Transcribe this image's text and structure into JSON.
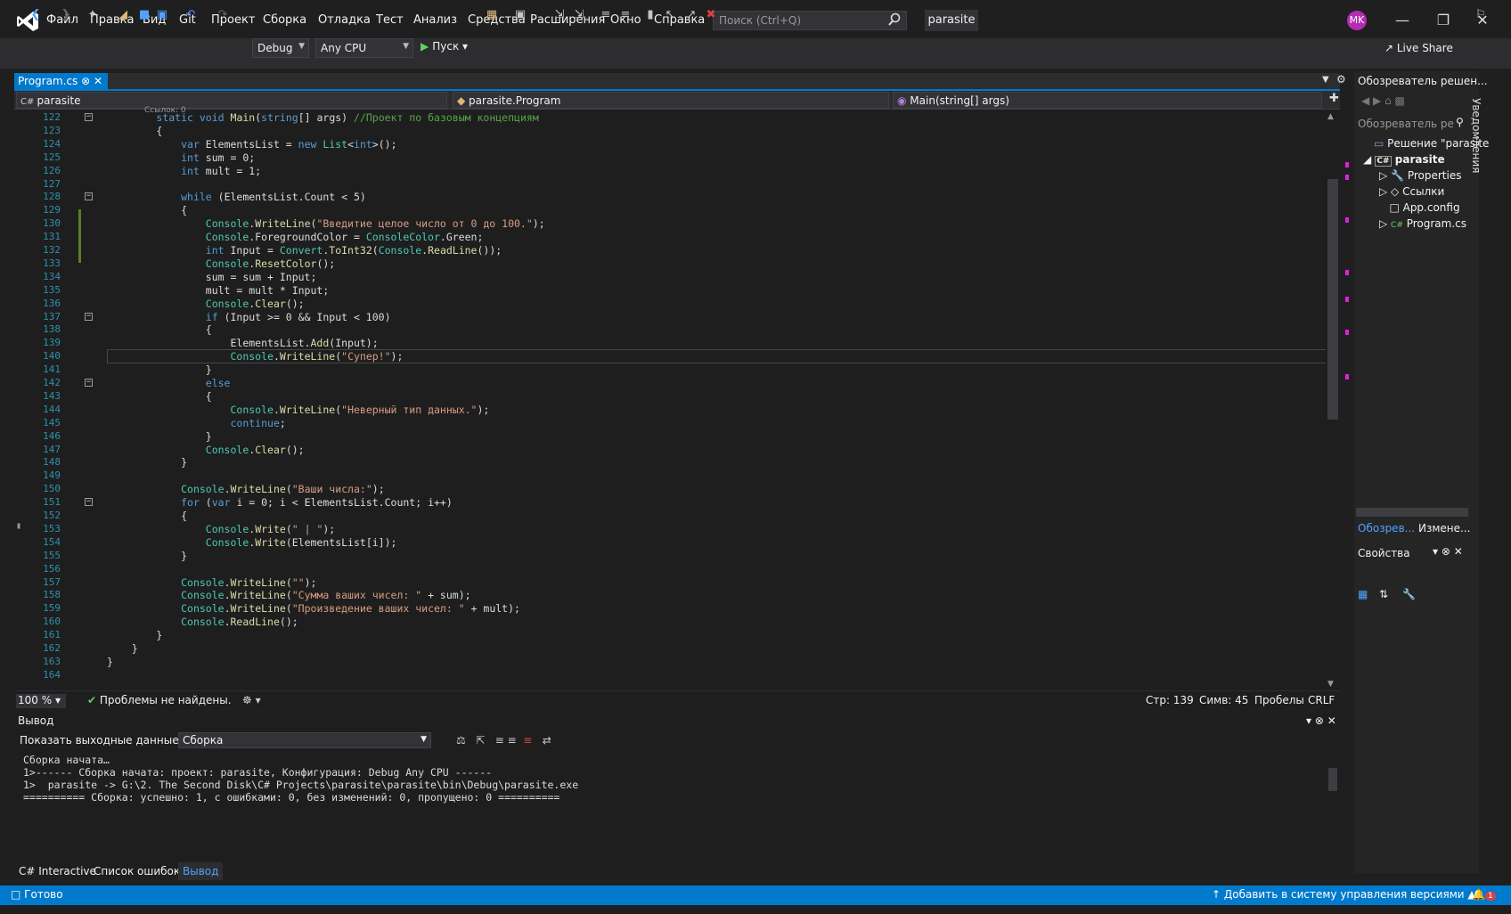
{
  "menu": {
    "items": [
      "Файл",
      "Правка",
      "Вид",
      "Git",
      "Проект",
      "Сборка",
      "Отладка",
      "Тест",
      "Анализ",
      "Средства",
      "Расширения",
      "Окно",
      "Справка"
    ],
    "search_placeholder": "Поиск (Ctrl+Q)",
    "project_name": "parasite",
    "avatar_initials": "MK"
  },
  "toolbar": {
    "config": "Debug",
    "platform": "Any CPU",
    "run_label": "Пуск",
    "live_share": "Live Share"
  },
  "editor": {
    "tab_label": "Program.cs",
    "nav_project": "parasite",
    "nav_class": "parasite.Program",
    "nav_member": "Main(string[] args)",
    "codelens": "Ссылок: 0",
    "zoom": "100 %",
    "issues": "Проблемы не найдены.",
    "line": "Стр: 139",
    "col": "Симв: 45",
    "whitespace": "Пробелы",
    "eol": "CRLF",
    "lines": [
      {
        "n": "122",
        "text": "        static void Main(string[] args) //Проект по базовым концепциям"
      },
      {
        "n": "123",
        "text": "        {"
      },
      {
        "n": "124",
        "text": "            var ElementsList = new List<int>();"
      },
      {
        "n": "125",
        "text": "            int sum = 0;"
      },
      {
        "n": "126",
        "text": "            int mult = 1;"
      },
      {
        "n": "127",
        "text": ""
      },
      {
        "n": "128",
        "text": "            while (ElementsList.Count < 5)"
      },
      {
        "n": "129",
        "text": "            {"
      },
      {
        "n": "130",
        "text": "                Console.WriteLine(\"Введитие целое число от 0 до 100.\");"
      },
      {
        "n": "131",
        "text": "                Console.ForegroundColor = ConsoleColor.Green;"
      },
      {
        "n": "132",
        "text": "                int Input = Convert.ToInt32(Console.ReadLine());"
      },
      {
        "n": "133",
        "text": "                Console.ResetColor();"
      },
      {
        "n": "134",
        "text": "                sum = sum + Input;"
      },
      {
        "n": "135",
        "text": "                mult = mult * Input;"
      },
      {
        "n": "136",
        "text": "                Console.Clear();"
      },
      {
        "n": "137",
        "text": "                if (Input >= 0 && Input < 100)"
      },
      {
        "n": "138",
        "text": "                {"
      },
      {
        "n": "139",
        "text": "                    ElementsList.Add(Input);"
      },
      {
        "n": "140",
        "text": "                    Console.WriteLine(\"Супер!\");"
      },
      {
        "n": "141",
        "text": "                }"
      },
      {
        "n": "142",
        "text": "                else"
      },
      {
        "n": "143",
        "text": "                {"
      },
      {
        "n": "144",
        "text": "                    Console.WriteLine(\"Неверный тип данных.\");"
      },
      {
        "n": "145",
        "text": "                    continue;"
      },
      {
        "n": "146",
        "text": "                }"
      },
      {
        "n": "147",
        "text": "                Console.Clear();"
      },
      {
        "n": "148",
        "text": "            }"
      },
      {
        "n": "149",
        "text": ""
      },
      {
        "n": "150",
        "text": "            Console.WriteLine(\"Ваши числа:\");"
      },
      {
        "n": "151",
        "text": "            for (var i = 0; i < ElementsList.Count; i++)"
      },
      {
        "n": "152",
        "text": "            {"
      },
      {
        "n": "153",
        "text": "                Console.Write(\" | \");"
      },
      {
        "n": "154",
        "text": "                Console.Write(ElementsList[i]);"
      },
      {
        "n": "155",
        "text": "            }"
      },
      {
        "n": "156",
        "text": ""
      },
      {
        "n": "157",
        "text": "            Console.WriteLine(\"\");"
      },
      {
        "n": "158",
        "text": "            Console.WriteLine(\"Сумма ваших чисел: \" + sum);"
      },
      {
        "n": "159",
        "text": "            Console.WriteLine(\"Произведение ваших чисел: \" + mult);"
      },
      {
        "n": "160",
        "text": "            Console.ReadLine();"
      },
      {
        "n": "161",
        "text": "        }"
      },
      {
        "n": "162",
        "text": "    }"
      },
      {
        "n": "163",
        "text": "}"
      },
      {
        "n": "164",
        "text": ""
      }
    ]
  },
  "solution": {
    "title": "Обозреватель решен...",
    "search": "Обозреватель ре",
    "root": "Решение \"parasite",
    "project": "parasite",
    "items": [
      "Properties",
      "Ссылки",
      "App.config",
      "Program.cs"
    ],
    "tab1": "Обозрев...",
    "tab2": "Измене...",
    "props_title": "Свойства",
    "vertical_tab": "Уведомления"
  },
  "output": {
    "title": "Вывод",
    "show_label": "Показать выходные данные из:",
    "source": "Сборка",
    "lines": [
      "Сборка начата…",
      "1>------ Сборка начата: проект: parasite, Конфигурация: Debug Any CPU ------",
      "1>  parasite -> G:\\2. The Second Disk\\C# Projects\\parasite\\parasite\\bin\\Debug\\parasite.exe",
      "========== Сборка: успешно: 1, с ошибками: 0, без изменений: 0, пропущено: 0 =========="
    ]
  },
  "bottom_tabs": [
    "C# Interactive",
    "Список ошибок",
    "Вывод"
  ],
  "status": {
    "ready": "Готово",
    "vcs": "Добавить в систему управления версиями",
    "notifications": "1"
  }
}
